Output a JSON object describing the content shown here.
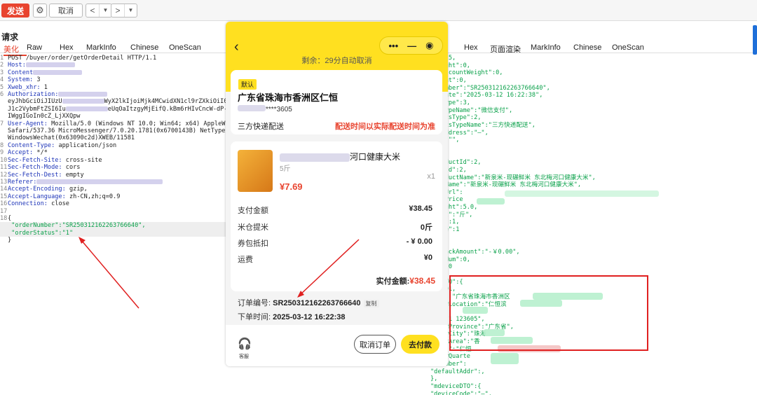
{
  "toolbar": {
    "send": "发送",
    "cancel": "取消",
    "prev": "<",
    "next": ">",
    "dropdown": "▼",
    "gear_icon": "gear-icon"
  },
  "request": {
    "title": "请求",
    "tabs": [
      "美化",
      "Raw",
      "Hex",
      "MarkInfo",
      "Chinese",
      "OneScan"
    ],
    "lines": [
      {
        "no": "1",
        "text": "POST /buyer/order/getOrderDetail HTTP/1.1"
      },
      {
        "no": "2",
        "key": "Host:",
        "val": ""
      },
      {
        "no": "3",
        "key": "Content",
        "val": ""
      },
      {
        "no": "4",
        "key": "System:",
        "val": " 3"
      },
      {
        "no": "5",
        "key": "Xweb_xhr:",
        "val": " 1"
      },
      {
        "no": "6",
        "key": "Authorization:",
        "val": ""
      },
      {
        "no": "",
        "text": "eyJhbGciOiJIUzU",
        "tail": "WyX2lkIjoiMjk4MCwidXN1cl9rZXkiOiI0YmE"
      },
      {
        "no": "",
        "text": "J1c2VybmFtZSI6Iu",
        "tail": "eUqOaItzgyMjEifQ.kBm6rHIvCncW-dP-ie"
      },
      {
        "no": "",
        "text": "IWggIGoIn0cZ_LjXXQpw"
      },
      {
        "no": "7",
        "key": "User-Agent:",
        "val": " Mozilla/5.0 (Windows NT 10.0; Win64; x64) AppleWebKi"
      },
      {
        "no": "",
        "text": "Safari/537.36 MicroMessenger/7.0.20.1781(0x6700143B) NetType/WIF"
      },
      {
        "no": "",
        "text": "WindowsWechat(0x63090c2d)XWEB/11581"
      },
      {
        "no": "8",
        "key": "Content-Type:",
        "val": " application/json"
      },
      {
        "no": "9",
        "key": "Accept:",
        "val": " */*"
      },
      {
        "no": "10",
        "key": "Sec-Fetch-Site:",
        "val": " cross-site"
      },
      {
        "no": "11",
        "key": "Sec-Fetch-Mode:",
        "val": " cors"
      },
      {
        "no": "12",
        "key": "Sec-Fetch-Dest:",
        "val": " empty"
      },
      {
        "no": "13",
        "key": "Referer:",
        "val": ""
      },
      {
        "no": "14",
        "key": "Accept-Encoding:",
        "val": " gzip,"
      },
      {
        "no": "15",
        "key": "Accept-Language:",
        "val": " zh-CN,zh;q=0.9"
      },
      {
        "no": "16",
        "key": "Connection:",
        "val": " close"
      },
      {
        "no": "17",
        "text": ""
      },
      {
        "no": "18",
        "text": "{"
      },
      {
        "no": "",
        "text": "  \"orderNumber\":\"SR250312162263766640\",",
        "json": true
      },
      {
        "no": "",
        "text": "  \"orderStatus\":\"1\"",
        "json": true
      },
      {
        "no": "",
        "text": "}"
      }
    ]
  },
  "response": {
    "tabs": [
      "Hex",
      "页面渲染",
      "MarkInfo",
      "Chinese",
      "OneScan"
    ],
    "lines": [
      "ght\":5,",
      "eWeight\":0,",
      "alDiscountWeight\":0,",
      "Weight\":0,",
      "erNumber\":\"SR250312162263766640\",",
      "ateDate\":\"2025-03-12 16:22:38\",",
      "entType\":3,",
      "entTypeName\":\"微信支付\",",
      "isticsType\":2,",
      "isticsTypeName\":\"三方快递配送\",",
      "iceAddress\":\"—\",",
      "ark\":\"\",",
      "s\":[",
      "",
      "\"productId\":2,",
      "\"skuId\":2,",
      "\"productName\":\"新泉米-现碾鲜米 东北梅河口健康大米\",",
      "\"skuName\":\"新泉米-现碾鲜米 东北梅河口健康大米\",",
      "\"skuUrl\":",
      "\"skuPrice",
      "\"weight\":5.0,",
      "\"unit\":\"斤\",",
      "\"num\":1,",
      "\"type\":1",
      "",
      "",
      "ponPackAmount\":\"-￥0.00\",",
      "celsNum\":0,",
      "one\":0",
      "",
      "eryDTO\":{",
      ":12201,",
      "ress\":\"广东省珠海市香洲区",
      "eiverLocation\":\"仁恒滨",
      "e\":",
      "ne\":\"1       123605\",",
      "eiverProvince\":\"广东省\",",
      "eiverCity\":\"珠海",
      "eiverArea\":\"香",
      "rters\":\"仁恒",
      "eiverQuarte",
      "seNumber\":",
      "\"defaultAddr\":,",
      "},",
      "\"mdeviceDTO\":{",
      "\"deviceCode\":\"—\","
    ]
  },
  "phone": {
    "countdown": "剩余：29分自动取消",
    "address_tag": "默认",
    "address": "广东省珠海市香洲区仁恒",
    "contact": "****3605",
    "delivery": "三方快递配送",
    "delivery_note": "配送时间以实际配送时间为准",
    "product_name": "河口健康大米",
    "product_spec": "5斤",
    "product_qty": "x1",
    "product_price": "¥7.69",
    "rows": [
      {
        "label": "支付金额",
        "value": "¥38.45"
      },
      {
        "label": "米仓提米",
        "value": "0斤"
      },
      {
        "label": "券包抵扣",
        "value": "- ¥ 0.00"
      },
      {
        "label": "运费",
        "value": "¥0"
      }
    ],
    "total_label": "实付金额:",
    "total_value": "¥38.45",
    "order_no_label": "订单编号:",
    "order_no": "SR250312162263766640",
    "copy": "复制",
    "order_time_label": "下单时间:",
    "order_time": "2025-03-12 16:22:38",
    "service": "客服",
    "cancel_order": "取消订单",
    "pay": "去付款"
  }
}
